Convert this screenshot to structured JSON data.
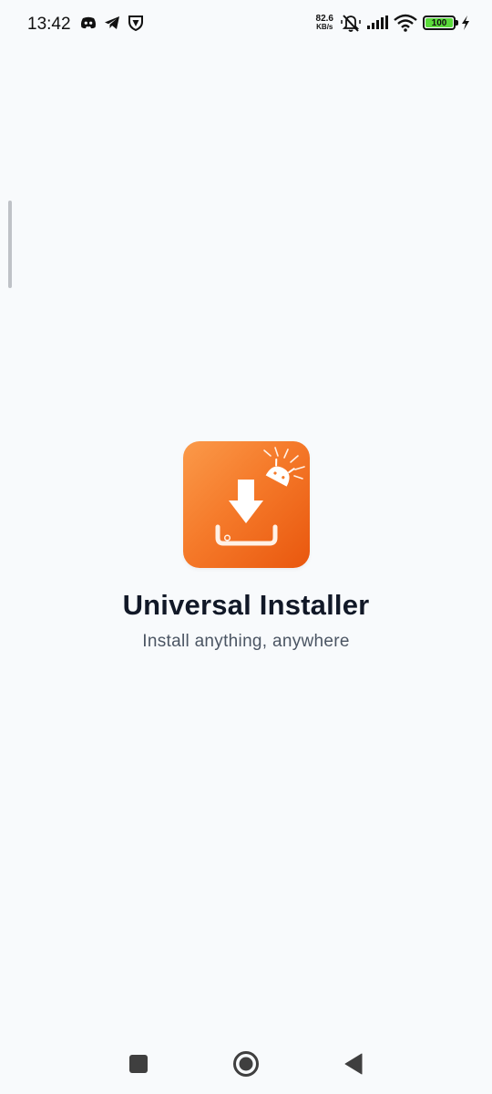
{
  "status_bar": {
    "time": "13:42",
    "net_speed_value": "82.6",
    "net_speed_unit": "KB/s",
    "battery_level": "100",
    "icons": [
      "discord-icon",
      "telegram-icon",
      "vpn-shield-icon",
      "muted-bell-icon",
      "signal-icon",
      "wifi-icon",
      "battery-icon",
      "charging-bolt-icon"
    ],
    "battery_color": "#5ADB3A"
  },
  "app": {
    "title": "Universal Installer",
    "tagline": "Install anything, anywhere",
    "icon_name": "installer-app-icon",
    "accent_color": "#F57A2A"
  },
  "nav_bar": {
    "buttons": [
      "recents-button",
      "home-button",
      "back-button"
    ]
  }
}
